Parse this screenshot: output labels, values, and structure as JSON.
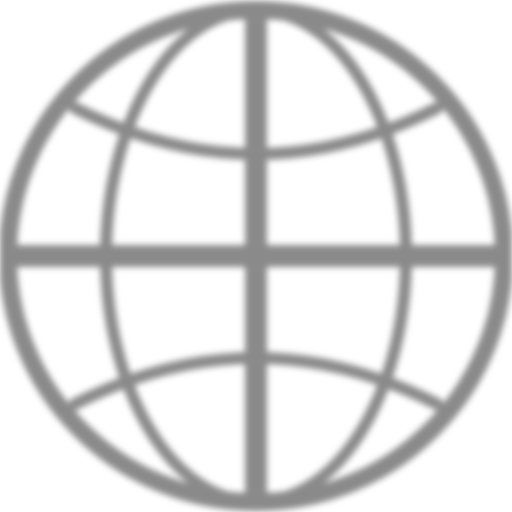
{
  "icon": {
    "name": "globe-icon",
    "stroke_color": "#8a8a8a",
    "background_color": "#ffffff"
  }
}
